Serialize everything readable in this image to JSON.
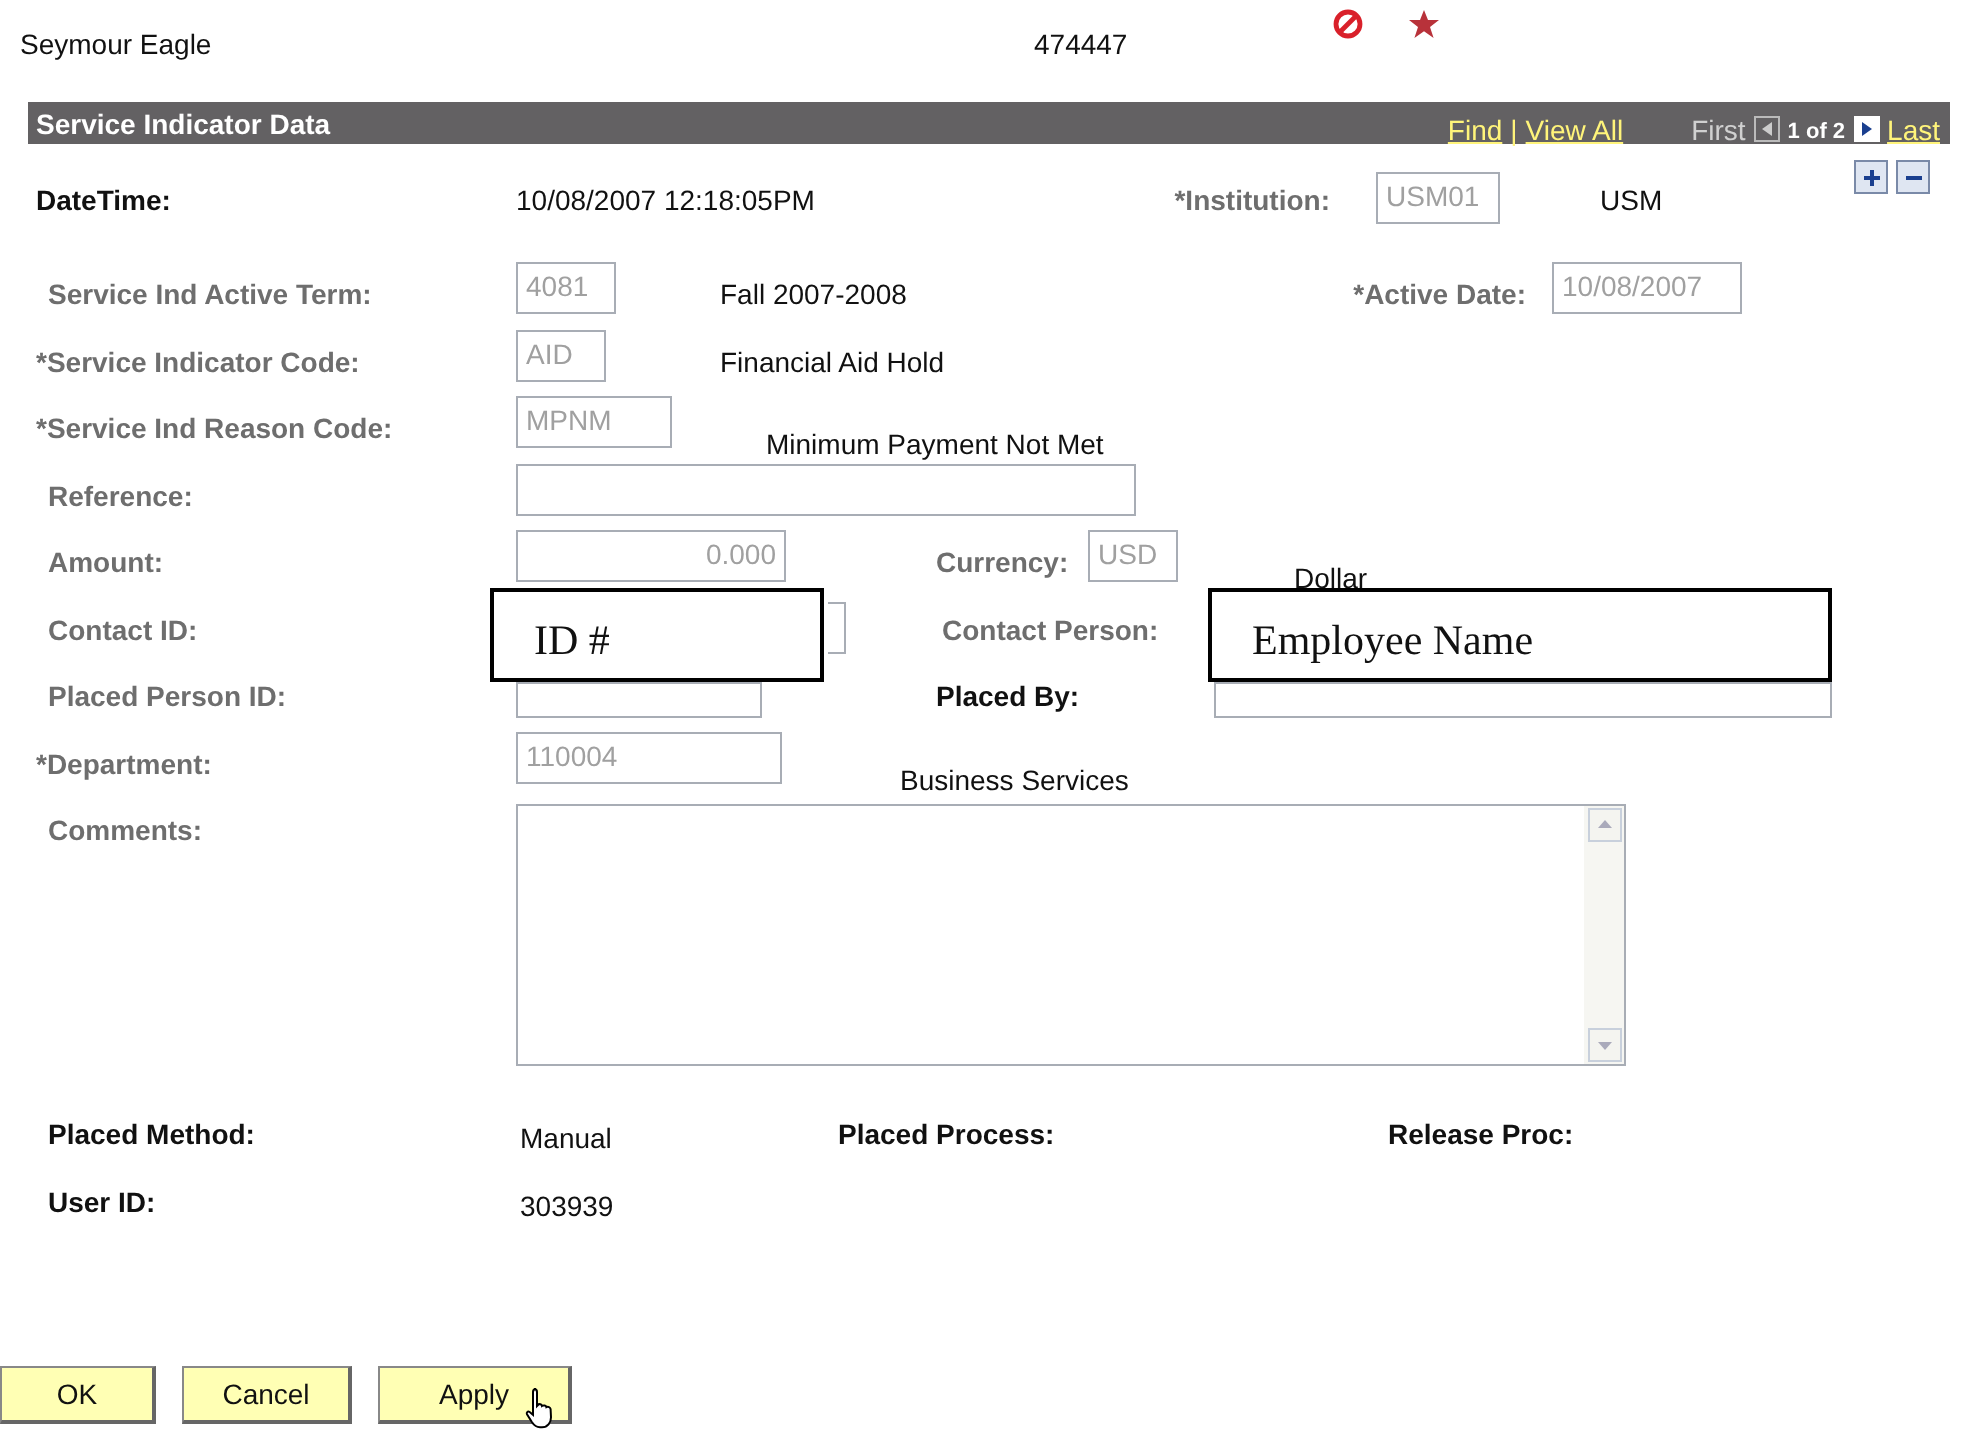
{
  "header": {
    "name": "Seymour Eagle",
    "id": "474447"
  },
  "section": {
    "title": "Service Indicator Data",
    "find": "Find",
    "separator": "|",
    "view_all": "View All",
    "first": "First",
    "page": "1 of 2",
    "last": "Last"
  },
  "datetime": {
    "label": "DateTime:",
    "value": "10/08/2007 12:18:05PM"
  },
  "institution": {
    "label": "*Institution:",
    "value": "USM01",
    "description": "USM"
  },
  "active_term": {
    "label": "Service Ind Active Term:",
    "value": "4081",
    "description": "Fall 2007-2008"
  },
  "active_date": {
    "label": "*Active Date:",
    "value": "10/08/2007"
  },
  "indicator_code": {
    "label": "*Service Indicator Code:",
    "value": "AID",
    "description": "Financial Aid Hold"
  },
  "reason_code": {
    "label": "*Service Ind Reason Code:",
    "value": "MPNM",
    "description": "Minimum Payment Not Met"
  },
  "reference": {
    "label": "Reference:"
  },
  "amount": {
    "label": "Amount:",
    "value": "0.000"
  },
  "currency": {
    "label": "Currency:",
    "value": "USD",
    "description": "Dollar"
  },
  "contact_id": {
    "label": "Contact ID:"
  },
  "contact_person": {
    "label": "Contact Person:"
  },
  "placed_person_id": {
    "label": "Placed Person ID:"
  },
  "placed_by": {
    "label": "Placed By:"
  },
  "department": {
    "label": "*Department:",
    "value": "110004",
    "description": "Business Services"
  },
  "comments": {
    "label": "Comments:"
  },
  "placed_method": {
    "label": "Placed Method:",
    "value": "Manual"
  },
  "placed_process": {
    "label": "Placed Process:"
  },
  "release_proc": {
    "label": "Release Proc:"
  },
  "user_id": {
    "label": "User ID:",
    "value": "303939"
  },
  "callouts": [
    "ID #",
    "Employee Name"
  ],
  "buttons": [
    "OK",
    "Cancel",
    "Apply"
  ]
}
